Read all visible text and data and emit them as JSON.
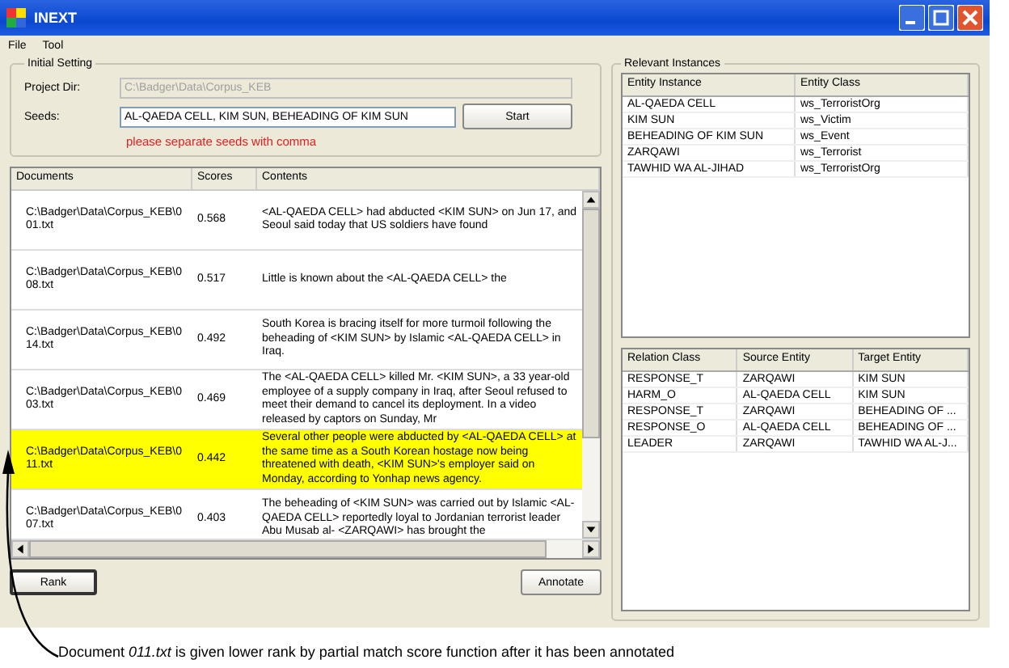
{
  "window": {
    "title": "INEXT"
  },
  "menu": [
    "File",
    "Tool"
  ],
  "initial_setting": {
    "title": "Initial Setting",
    "project_dir": {
      "label": "Project Dir:",
      "value": "C:\\Badger\\Data\\Corpus_KEB",
      "disabled": true
    },
    "seeds": {
      "label": "Seeds:",
      "value": "AL-QAEDA CELL, KIM SUN, BEHEADING OF KIM SUN"
    },
    "start_button": "Start",
    "hint": "please separate seeds with comma"
  },
  "documents": {
    "columns": [
      "Documents",
      "Scores",
      "Contents"
    ],
    "rows": [
      {
        "document": "C:\\Badger\\Data\\Corpus_KEB\\001.txt",
        "score": "0.568",
        "contents": "<AL-QAEDA CELL> had abducted <KIM SUN> on Jun 17, and Seoul said today that US soldiers have found",
        "selected": false
      },
      {
        "document": "C:\\Badger\\Data\\Corpus_KEB\\008.txt",
        "score": "0.517",
        "contents": "Little is known about the <AL-QAEDA CELL> the",
        "selected": false
      },
      {
        "document": "C:\\Badger\\Data\\Corpus_KEB\\014.txt",
        "score": "0.492",
        "contents": "South Korea is bracing itself for more turmoil following the beheading of <KIM SUN> by Islamic <AL-QAEDA CELL> in Iraq.",
        "selected": false
      },
      {
        "document": "C:\\Badger\\Data\\Corpus_KEB\\003.txt",
        "score": "0.469",
        "contents": "The <AL-QAEDA CELL> killed Mr. <KIM SUN>, a 33 year-old employee of a supply company in Iraq, after Seoul refused to meet their demand to cancel its deployment. In a video released by captors on Sunday, Mr",
        "selected": false
      },
      {
        "document": "C:\\Badger\\Data\\Corpus_KEB\\011.txt",
        "score": "0.442",
        "contents": "Several other people were abducted by <AL-QAEDA CELL> at the same time as a South Korean hostage now being threatened with death, <KIM SUN>'s employer said on Monday, according to Yonhap news agency.",
        "selected": true
      },
      {
        "document": "C:\\Badger\\Data\\Corpus_KEB\\007.txt",
        "score": "0.403",
        "contents": "The beheading of <KIM SUN> was carried out by Islamic <AL-QAEDA CELL> reportedly loyal to Jordanian terrorist leader Abu Musab al- <ZARQAWI> has brought the",
        "selected": false
      }
    ]
  },
  "buttons": {
    "rank": "Rank",
    "annotate": "Annotate"
  },
  "relevant_instances": {
    "title": "Relevant Instances",
    "entities": {
      "columns": [
        "Entity Instance",
        "Entity Class"
      ],
      "rows": [
        [
          "AL-QAEDA CELL",
          "ws_TerroristOrg"
        ],
        [
          "KIM SUN",
          "ws_Victim"
        ],
        [
          "BEHEADING OF KIM SUN",
          "ws_Event"
        ],
        [
          "ZARQAWI",
          "ws_Terrorist"
        ],
        [
          "TAWHID WA AL-JIHAD",
          "ws_TerroristOrg"
        ]
      ]
    },
    "relations": {
      "columns": [
        "Relation Class",
        "Source Entity",
        "Target Entity"
      ],
      "rows": [
        [
          "RESPONSE_T",
          "ZARQAWI",
          "KIM SUN"
        ],
        [
          "HARM_O",
          "AL-QAEDA CELL",
          "KIM SUN"
        ],
        [
          "RESPONSE_T",
          "ZARQAWI",
          "BEHEADING OF ..."
        ],
        [
          "RESPONSE_O",
          "AL-QAEDA CELL",
          "BEHEADING OF ..."
        ],
        [
          "LEADER",
          "ZARQAWI",
          "TAWHID WA AL-J..."
        ]
      ]
    }
  },
  "caption": "Document *011.txt* is given  lower rank by partial match score function after it has been annotated"
}
